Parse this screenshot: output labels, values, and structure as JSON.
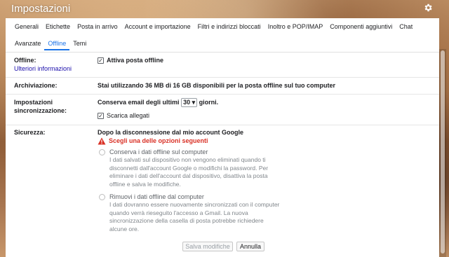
{
  "window": {
    "title": "Impostazioni"
  },
  "icons": {
    "settings": "gear-icon",
    "warning": "warning-icon"
  },
  "colors": {
    "accent": "#1a73e8",
    "warning": "#d93025",
    "link": "#1a0dab"
  },
  "tabs": {
    "row1": [
      "Generali",
      "Etichette",
      "Posta in arrivo",
      "Account e importazione",
      "Filtri e indirizzi bloccati",
      "Inoltro e POP/IMAP",
      "Componenti aggiuntivi",
      "Chat"
    ],
    "row2": [
      "Avanzate",
      "Offline",
      "Temi"
    ],
    "active": "Offline"
  },
  "offline": {
    "label": "Offline:",
    "link": "Ulteriori informazioni",
    "checkbox_label": "Attiva posta offline",
    "checked": true
  },
  "storage": {
    "label": "Archiviazione:",
    "text": "Stai utilizzando 36 MB di 16 GB disponibili per la posta offline sul tuo computer"
  },
  "sync": {
    "label_line1": "Impostazioni",
    "label_line2": "sincronizzazione:",
    "prefix": "Conserva email degli ultimi",
    "days_value": "30",
    "suffix": "giorni.",
    "attachments_label": "Scarica allegati",
    "attachments_checked": true
  },
  "security": {
    "label": "Sicurezza:",
    "heading": "Dopo la disconnessione dal mio account Google",
    "warning": "Scegli una delle opzioni seguenti",
    "option1": {
      "title": "Conserva i dati offline sul computer",
      "desc": "I dati salvati sul dispositivo non vengono eliminati quando ti disconnetti dall'account Google o modifichi la password. Per eliminare i dati dell'account dal dispositivo, disattiva la posta offline e salva le modifiche."
    },
    "option2": {
      "title": "Rimuovi i dati offline dal computer",
      "desc": "I dati dovranno essere nuovamente sincronizzati con il computer quando verrà rieseguito l'accesso a Gmail. La nuova sincronizzazione della casella di posta potrebbe richiedere alcune ore."
    }
  },
  "buttons": {
    "save": "Salva modifiche",
    "cancel": "Annulla"
  }
}
